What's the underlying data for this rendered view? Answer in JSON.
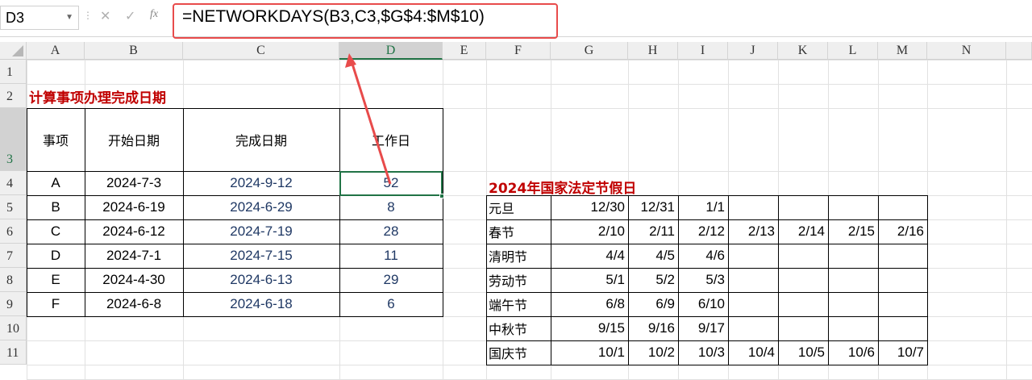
{
  "name_box": "D3",
  "formula": "=NETWORKDAYS(B3,C3,$G$4:$M$10)",
  "columns": [
    "A",
    "B",
    "C",
    "D",
    "E",
    "F",
    "G",
    "H",
    "I",
    "J",
    "K",
    "L",
    "M",
    "N"
  ],
  "rows": [
    "1",
    "2",
    "3",
    "4",
    "5",
    "6",
    "7",
    "8",
    "9",
    "10",
    "11"
  ],
  "title_left": "计算事项办理完成日期",
  "left_table": {
    "headers": [
      "事项",
      "开始日期",
      "完成日期",
      "工作日"
    ],
    "rows": [
      [
        "A",
        "2024-7-3",
        "2024-9-12",
        "52"
      ],
      [
        "B",
        "2024-6-19",
        "2024-6-29",
        "8"
      ],
      [
        "C",
        "2024-6-12",
        "2024-7-19",
        "28"
      ],
      [
        "D",
        "2024-7-1",
        "2024-7-15",
        "11"
      ],
      [
        "E",
        "2024-4-30",
        "2024-6-13",
        "29"
      ],
      [
        "F",
        "2024-6-8",
        "2024-6-18",
        "6"
      ]
    ]
  },
  "title_right": "2024年国家法定节假日",
  "holiday_table": {
    "rows": [
      [
        "元旦",
        "12/30",
        "12/31",
        "1/1",
        "",
        "",
        "",
        ""
      ],
      [
        "春节",
        "2/10",
        "2/11",
        "2/12",
        "2/13",
        "2/14",
        "2/15",
        "2/16"
      ],
      [
        "清明节",
        "4/4",
        "4/5",
        "4/6",
        "",
        "",
        "",
        ""
      ],
      [
        "劳动节",
        "5/1",
        "5/2",
        "5/3",
        "",
        "",
        "",
        ""
      ],
      [
        "端午节",
        "6/8",
        "6/9",
        "6/10",
        "",
        "",
        "",
        ""
      ],
      [
        "中秋节",
        "9/15",
        "9/16",
        "9/17",
        "",
        "",
        "",
        ""
      ],
      [
        "国庆节",
        "10/1",
        "10/2",
        "10/3",
        "10/4",
        "10/5",
        "10/6",
        "10/7"
      ]
    ]
  },
  "colors": {
    "accent_red": "#e84b4b",
    "title_red": "#c00000",
    "excel_green": "#217346",
    "date_blue": "#1f3864"
  },
  "icons": [
    "cancel-icon",
    "enter-icon",
    "function-icon",
    "dropdown-icon"
  ]
}
